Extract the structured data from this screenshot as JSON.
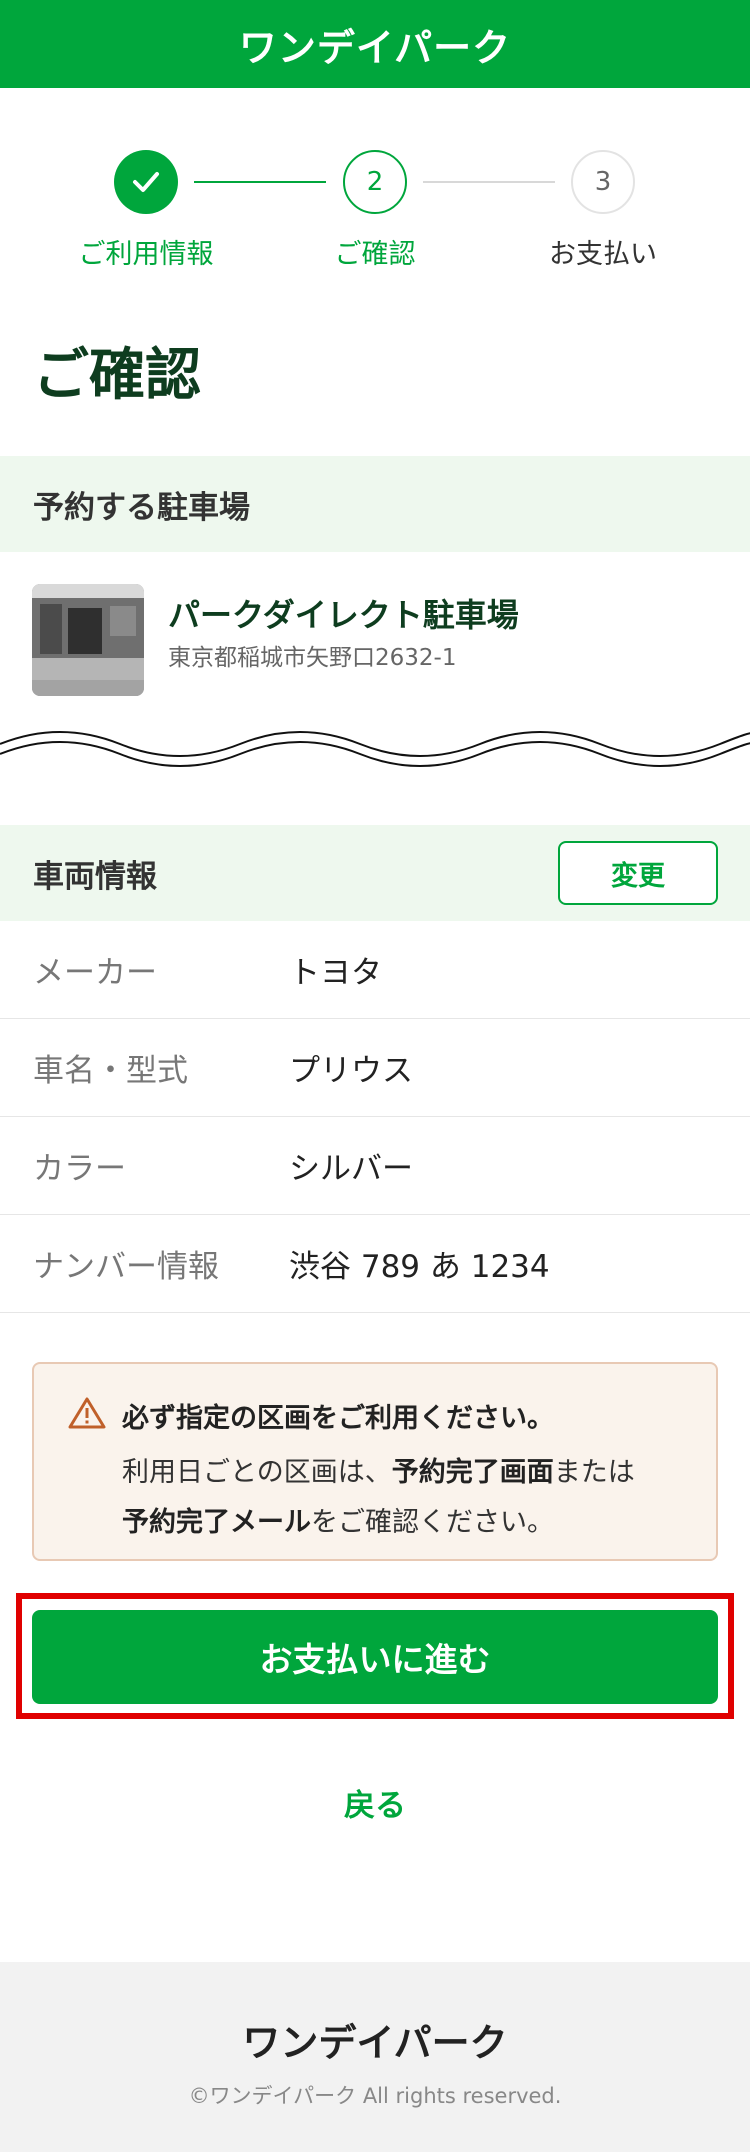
{
  "header": {
    "logo": "ワンデイパーク"
  },
  "stepper": {
    "steps": [
      {
        "number": "",
        "label": "ご利用情報"
      },
      {
        "number": "2",
        "label": "ご確認"
      },
      {
        "number": "3",
        "label": "お支払い"
      }
    ]
  },
  "page_title": "ご確認",
  "parking": {
    "section_title": "予約する駐車場",
    "name": "パークダイレクト駐車場",
    "address": "東京都稲城市矢野口2632-1"
  },
  "vehicle": {
    "section_title": "車両情報",
    "change_label": "変更",
    "rows": [
      {
        "key": "メーカー",
        "value": "トヨタ"
      },
      {
        "key": "車名・型式",
        "value": "プリウス"
      },
      {
        "key": "カラー",
        "value": "シルバー"
      },
      {
        "key": "ナンバー情報",
        "value": "渋谷 789 あ 1234"
      }
    ]
  },
  "notice": {
    "icon": "warning-icon",
    "title": "必ず指定の区画をご利用ください。",
    "body_part1": "利用日ごとの区画は、",
    "body_bold1": "予約完了画面",
    "body_part2": "または",
    "body_bold2": "予約完了メール",
    "body_part3": "をご確認ください。"
  },
  "actions": {
    "pay_label": "お支払いに進む",
    "back_label": "戻る"
  },
  "footer": {
    "logo": "ワンデイパーク",
    "copyright": "©ワンデイパーク All rights reserved."
  },
  "colors": {
    "brand_green": "#00a63c",
    "highlight_red": "#e00000",
    "notice_bg": "#faf3ec",
    "warning": "#c0602a"
  }
}
